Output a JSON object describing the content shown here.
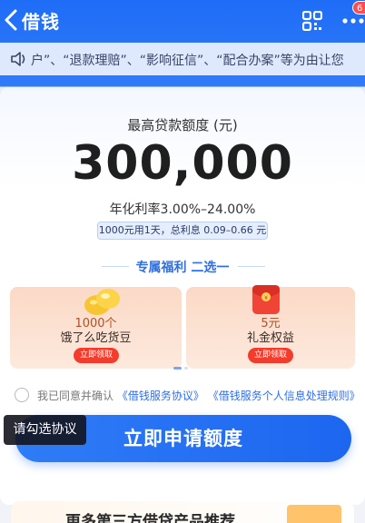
{
  "header": {
    "title": "借钱",
    "badge": "6"
  },
  "notice": {
    "text": "户”、“退款理赔”、“影响征信”、“配合办案”等为由让您"
  },
  "loan": {
    "label": "最高贷款额度 (元)",
    "amount": "300,000",
    "rate": "年化利率3.00%–24.00%",
    "interest": "1000元用1天，总利息 0.09–0.66 元"
  },
  "welfare": {
    "title": "专属福利 二选一",
    "items": [
      {
        "amount": "1000个",
        "name": "饿了么吃货豆",
        "button": "立即领取",
        "icon": "golden-bean-icon"
      },
      {
        "amount": "5元",
        "name": "礼金权益",
        "button": "立即领取",
        "icon": "red-packet-icon"
      }
    ]
  },
  "agreement": {
    "prefix": "我已同意并确认",
    "link1": "《借钱服务协议》",
    "link2": "《借钱服务个人信息处理规则》"
  },
  "tooltip": "请勾选协议",
  "apply_button": "立即申请额度",
  "bottom_banner": "更多第三方借贷产品推荐",
  "colors": {
    "brand_blue": "#1f6df7",
    "button_red": "#f43c2d"
  }
}
